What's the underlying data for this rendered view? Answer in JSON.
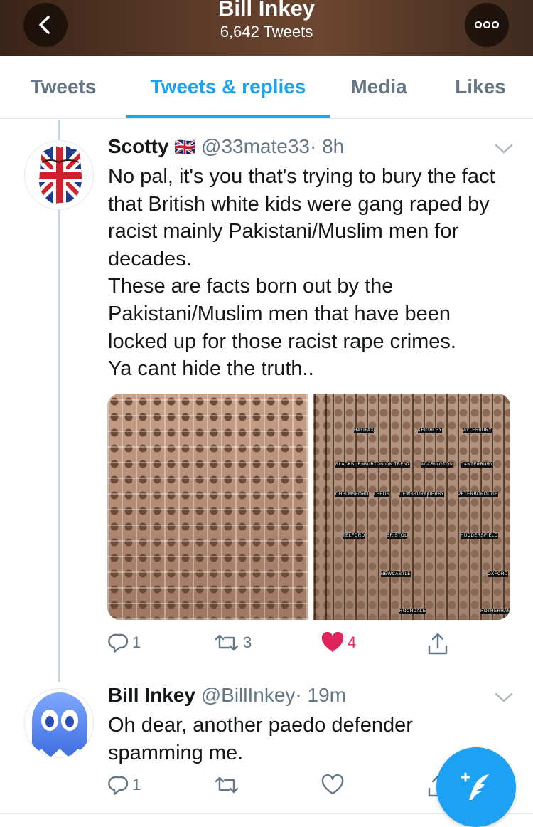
{
  "header": {
    "title": "Bill Inkey",
    "subtitle": "6,642 Tweets"
  },
  "tabs": [
    {
      "label": "Tweets"
    },
    {
      "label": "Tweets & replies"
    },
    {
      "label": "Media"
    },
    {
      "label": "Likes"
    }
  ],
  "colors": {
    "accent": "#1da1f2",
    "like": "#e0245e",
    "muted": "#657786"
  },
  "tweets": [
    {
      "name": "Scotty",
      "flag": "🇬🇧",
      "handle": "@33mate33",
      "time": "· 8h",
      "text": "No pal, it's you that's trying to bury the fact that British white kids were gang raped by racist mainly Pakistani/Muslim men for decades.\nThese are facts born out by the Pakistani/Muslim men that have been locked up for those racist rape crimes.\nYa cant hide the truth..",
      "media_captions": [
        "HALIFAX",
        "KEIGHLEY",
        "AYLESBURY",
        "BLACKBURN",
        "BURTON ON TRENT",
        "ACCRINGTON",
        "CANTERBURY",
        "CHELMSFORD",
        "LEEDS",
        "DEWSBURY",
        "DERBY",
        "PETERBOROUGH",
        "TELFORD",
        "BRISTOL",
        "HUDDERSFIELD",
        "NEWCASTLE",
        "OXFORD",
        "ROCHDALE",
        "ROTHERHAM"
      ],
      "replies": "1",
      "retweets": "3",
      "likes": "4",
      "liked": true
    },
    {
      "name": "Bill Inkey",
      "handle": "@BillInkey",
      "time": "· 19m",
      "text": "Oh dear, another paedo defender spamming me.",
      "replies": "1",
      "retweets": "",
      "likes": "",
      "liked": false
    }
  ],
  "icons": {
    "back": "chevron-left-icon",
    "more": "more-icon",
    "reply": "reply-icon",
    "retweet": "retweet-icon",
    "like": "heart-icon",
    "share": "share-icon",
    "compose": "compose-icon"
  }
}
